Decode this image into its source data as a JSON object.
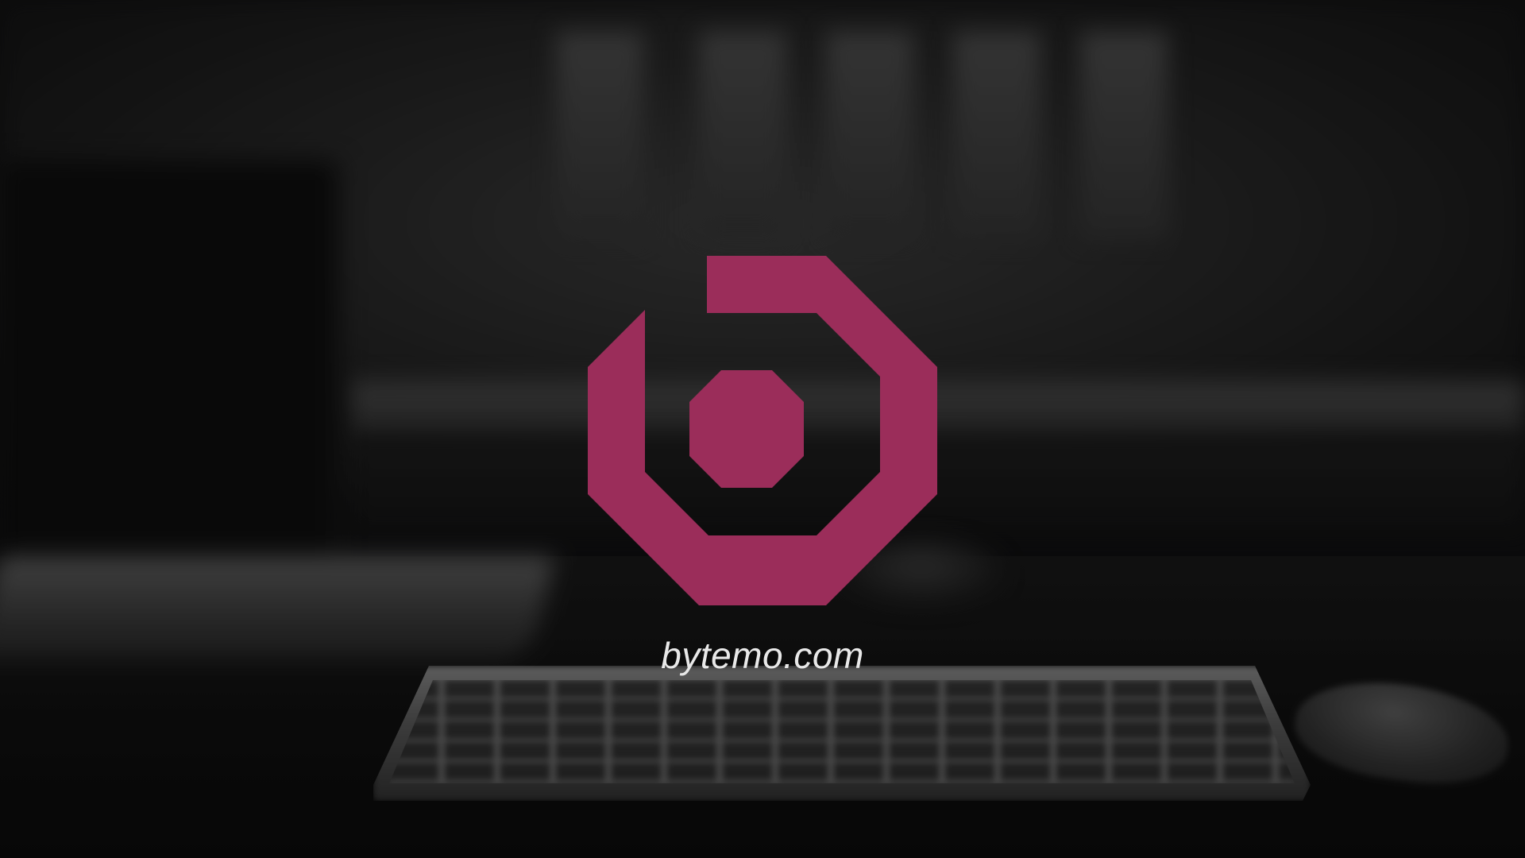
{
  "brand": {
    "url": "bytemo.com",
    "logo_icon": "octagon-b-logo",
    "accent_color": "#9b2d5a"
  },
  "background": {
    "description_icon": "desk-workspace-photo",
    "tone": "#151515"
  }
}
